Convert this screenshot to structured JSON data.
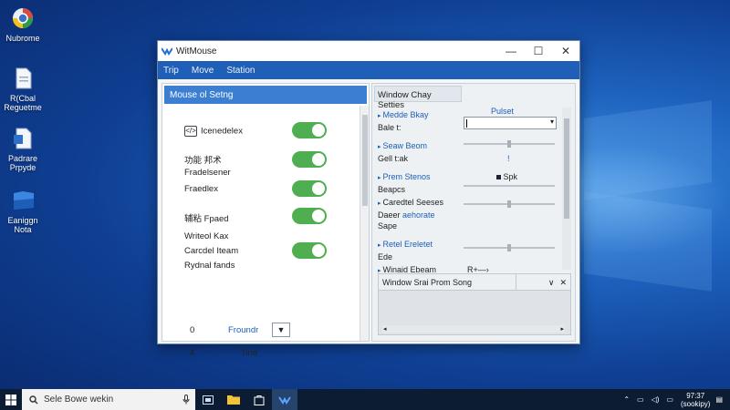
{
  "desktop": {
    "icons": [
      {
        "label": "Nubrome",
        "icon": "globe-icon"
      },
      {
        "label": "R(Cbal Reguetme",
        "icon": "document-icon"
      },
      {
        "label": "Padrare Prpyde",
        "icon": "document-icon"
      },
      {
        "label": "Eaniggn Nota",
        "icon": "folder-icon"
      }
    ]
  },
  "window": {
    "title": "WitMouse",
    "controls": {
      "minimize": "—",
      "maximize": "☐",
      "close": "✕"
    },
    "menu": [
      "Trip",
      "Move",
      "Station"
    ]
  },
  "left_panel": {
    "header": "Mouse ol Setng",
    "rows": {
      "r1": "Icenedelex",
      "r2": "功能 邦术",
      "r3": "Fradelsener",
      "r4": "Fraedlex",
      "r5": "辅粘 Fpaed",
      "r6": "Writeol Kax",
      "r7": "Carcdel Iteam",
      "r8": "Rydnal fands"
    },
    "bottom_row_a": {
      "num": "0",
      "label": "Froundr",
      "arrow": "▼"
    },
    "bottom_row_b": {
      "num": "4",
      "label": "Tind"
    }
  },
  "right_panel": {
    "tab": "Window Chay Setties",
    "row1": {
      "a": "Medde Bkay",
      "b": "Bale t:",
      "right": "Pulset"
    },
    "row2": {
      "a": "Seaw Beom",
      "b": "Gell t:ak",
      "right": "!"
    },
    "row3": {
      "a": "Prem Stenos",
      "b": "Beapcs",
      "right": "Spk"
    },
    "row4": {
      "a": "Caredtel Seeses",
      "b": "Daeer",
      "c": "aehorate",
      "d": "Sape"
    },
    "row5": {
      "a": "Retel Ereletet",
      "b": "Ede"
    },
    "row6": {
      "a": "Winaid Ebeam",
      "right": "R+—›"
    },
    "dropdown_arrow": "▾",
    "bottom_box": {
      "title": "Window Srai Prom Song",
      "ctrl1": "∨",
      "ctrl2": "✕",
      "left": "◂",
      "right": "▸"
    }
  },
  "taskbar": {
    "search_text": "Sele Bowe wekin",
    "time": "97:37",
    "date": "(sookipy)"
  }
}
